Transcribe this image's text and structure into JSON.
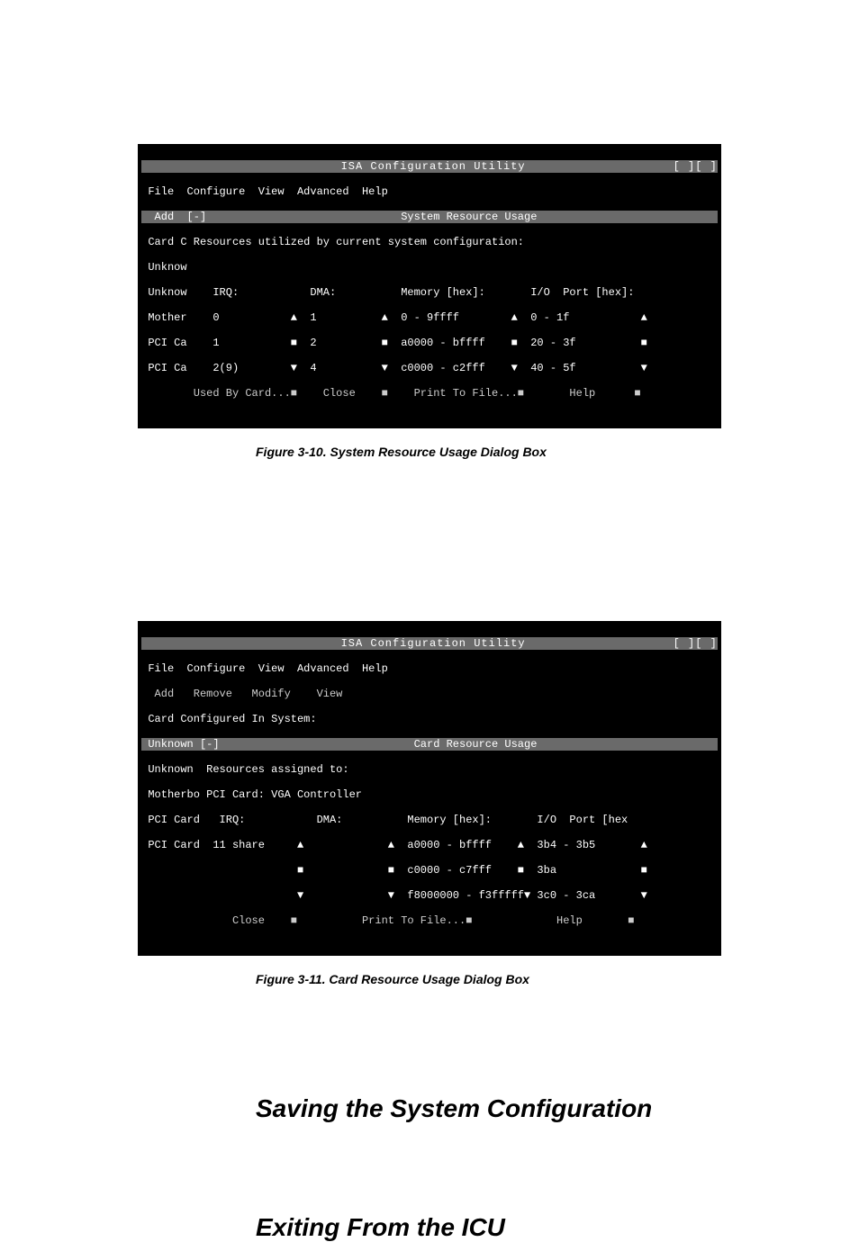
{
  "figure1": {
    "caption": "Figure 3-10.  System Resource Usage Dialog Box",
    "line_title": "                           ISA Configuration Utility                    [ ][ ]",
    "line_menu": " File  Configure  View  Advanced  Help                                         ",
    "line_submenu": "  Add  [-]                              System Resource Usage                  ",
    "line_info": " Card C Resources utilized by current system configuration:                    ",
    "line_head": " Unknow                                                                        ",
    "line_cols": " Unknow    IRQ:           DMA:          Memory [hex]:       I/O  Port [hex]:   ",
    "line_r1": " Mother    0           ▲  1          ▲  0 - 9ffff        ▲  0 - 1f           ▲ ",
    "line_r2": " PCI Ca    1           ■  2          ■  a0000 - bffff    ■  20 - 3f          ■ ",
    "line_r3": " PCI Ca    2(9)        ▼  4          ▼  c0000 - c2fff    ▼  40 - 5f          ▼ ",
    "line_btns": "        Used By Card...■    Close    ■    Print To File...■       Help      ■ "
  },
  "figure2": {
    "caption": "Figure 3-11.  Card Resource Usage Dialog Box",
    "line_title": "                           ISA Configuration Utility                    [ ][ ]",
    "line_menu": " File  Configure  View  Advanced  Help                                         ",
    "line_submenu": "  Add   Remove   Modify    View                                                ",
    "line_info": " Card Configured In System:                                                    ",
    "line_dlg": " Unknown [-]                              Card Resource Usage                  ",
    "line_r0": " Unknown  Resources assigned to:                                               ",
    "line_r1": " Motherbo PCI Card: VGA Controller                                             ",
    "line_cols": " PCI Card   IRQ:           DMA:          Memory [hex]:       I/O  Port [hex   ",
    "line_r2": " PCI Card  11 share     ▲             ▲  a0000 - bffff    ▲  3b4 - 3b5       ▲",
    "line_r3": "                        ■             ■  c0000 - c7fff    ■  3ba             ■",
    "line_r4": "                        ▼             ▼  f8000000 - f3fffff▼ 3c0 - 3ca       ▼",
    "line_btns": "              Close    ■          Print To File...■             Help       ■ "
  },
  "heading1": "Saving the System Configuration",
  "heading2": "Exiting From the ICU"
}
